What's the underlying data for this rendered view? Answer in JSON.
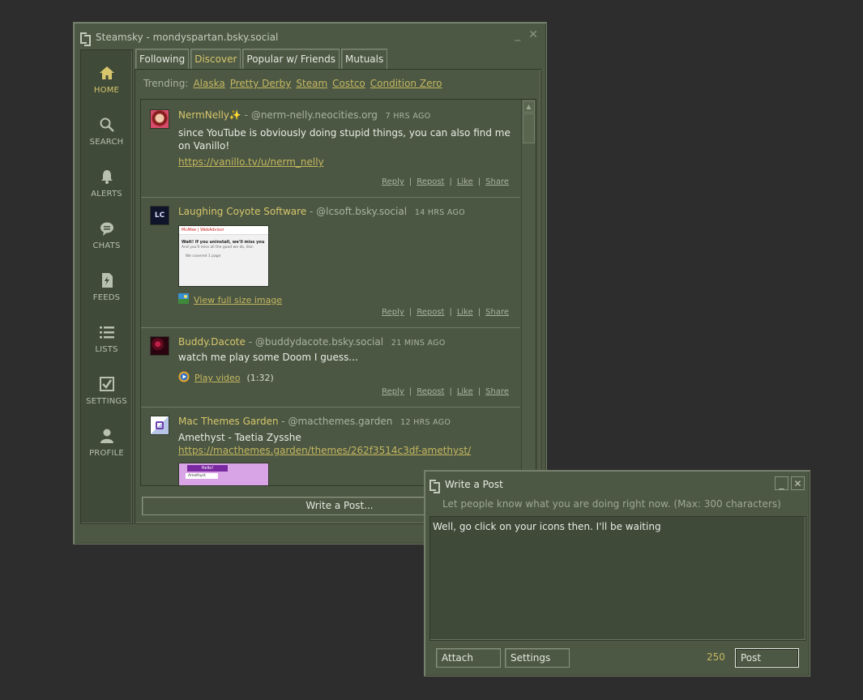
{
  "main_window": {
    "title": "Steamsky - mondyspartan.bsky.social",
    "minimize": "_",
    "close": "✕"
  },
  "sidebar": {
    "items": [
      {
        "label": "HOME",
        "icon": "home-icon",
        "active": true
      },
      {
        "label": "SEARCH",
        "icon": "search-icon"
      },
      {
        "label": "ALERTS",
        "icon": "bell-icon"
      },
      {
        "label": "CHATS",
        "icon": "chat-icon"
      },
      {
        "label": "FEEDS",
        "icon": "feed-icon"
      },
      {
        "label": "LISTS",
        "icon": "list-icon"
      },
      {
        "label": "SETTINGS",
        "icon": "checkbox-icon"
      },
      {
        "label": "PROFILE",
        "icon": "person-icon"
      }
    ]
  },
  "tabs": [
    {
      "label": "Following"
    },
    {
      "label": "Discover",
      "active": true
    },
    {
      "label": "Popular w/ Friends"
    },
    {
      "label": "Mutuals"
    }
  ],
  "trending": {
    "label": "Trending:",
    "topics": [
      "Alaska",
      "Pretty Derby",
      "Steam",
      "Costco",
      "Condition Zero"
    ]
  },
  "posts": [
    {
      "author": "NermNelly✨",
      "handle": "- @nerm-nelly.neocities.org",
      "time": "7 HRS AGO",
      "text": "since YouTube is obviously doing stupid things, you can also find me on Vanillo!",
      "link": "https://vanillo.tv/u/nerm_nelly"
    },
    {
      "author": "Laughing Coyote Software",
      "handle": "- @lcsoft.bsky.social",
      "time": "14 HRS AGO",
      "image_title": "McAfee | WebAdvisor",
      "image_heading": "Wait! If you uninstall, we'll miss you",
      "image_body": "And you'll miss all the good we do, like:",
      "image_item": "We covered 1 page",
      "media_label": "View full size image"
    },
    {
      "author": "Buddy.Dacote",
      "handle": "- @buddydacote.bsky.social",
      "time": "21 MINS AGO",
      "text": "watch me play some Doom I guess...",
      "media_label": "Play video",
      "duration": "(1:32)"
    },
    {
      "author": "Mac Themes Garden",
      "handle": "- @macthemes.garden",
      "time": "12 HRS AGO",
      "text": "Amethyst - Taetia Zysshe",
      "link": "https://macthemes.garden/themes/262f3514c3df-amethyst/",
      "image_hello": "Hello!",
      "image_sub": "Amethyst"
    }
  ],
  "actions": {
    "reply": "Reply",
    "repost": "Repost",
    "like": "Like",
    "share": "Share",
    "sep": "|"
  },
  "write_button": "Write a Post...",
  "compose": {
    "title": "Write a Post",
    "hint": "Let people know what you are doing right now. (Max: 300 characters)",
    "text": "Well, go click on your icons then. I'll be waiting",
    "attach": "Attach",
    "settings": "Settings",
    "char_count": "250",
    "post": "Post",
    "minimize": "_",
    "close": "✕"
  },
  "colors": {
    "window_bg": "#4c5844",
    "accent_gold": "#d7c66b",
    "link_gold": "#c6b75f",
    "desktop_bg": "#2d2d2d"
  }
}
